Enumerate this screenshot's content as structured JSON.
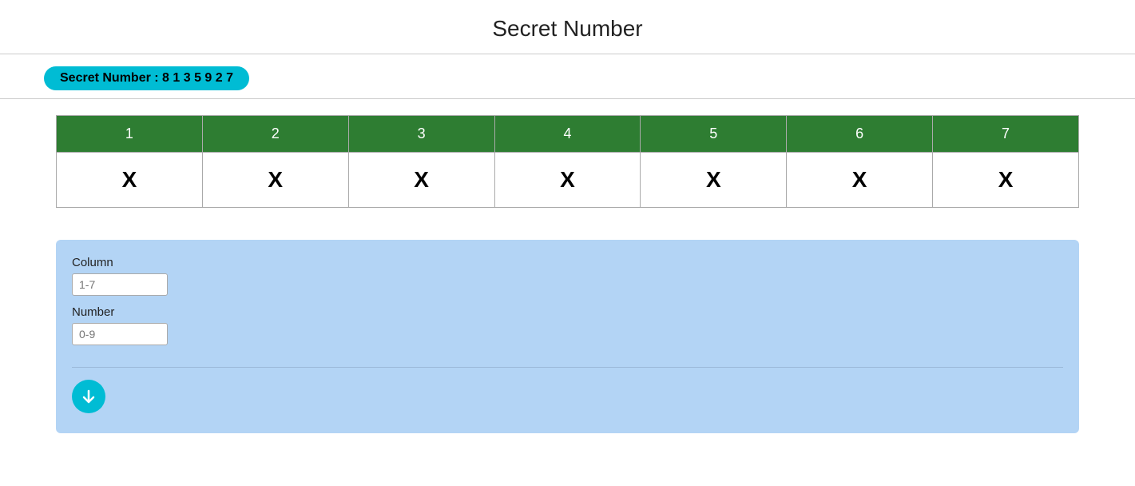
{
  "page": {
    "title": "Secret Number"
  },
  "secret_badge": {
    "label": "Secret Number : 8 1 3 5 9 2 7"
  },
  "table": {
    "columns": [
      {
        "header": "1",
        "value": "X"
      },
      {
        "header": "2",
        "value": "X"
      },
      {
        "header": "3",
        "value": "X"
      },
      {
        "header": "4",
        "value": "X"
      },
      {
        "header": "5",
        "value": "X"
      },
      {
        "header": "6",
        "value": "X"
      },
      {
        "header": "7",
        "value": "X"
      }
    ]
  },
  "form": {
    "column_label": "Column",
    "column_placeholder": "1-7",
    "number_label": "Number",
    "number_placeholder": "0-9",
    "submit_icon": "arrow-icon"
  }
}
